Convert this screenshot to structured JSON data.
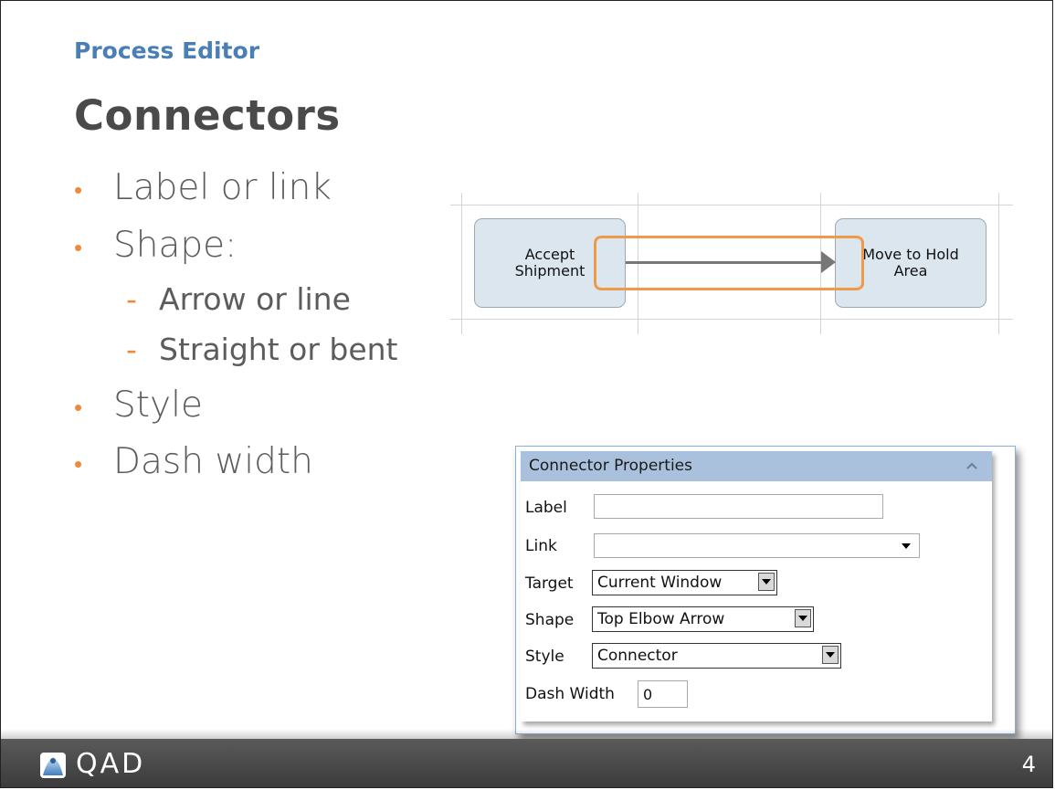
{
  "slide": {
    "subtitle": "Process Editor",
    "title": "Connectors",
    "bullets": [
      {
        "text": "Label or link"
      },
      {
        "text": "Shape:"
      },
      {
        "text": "Style"
      },
      {
        "text": "Dash width"
      }
    ],
    "sub_bullets": [
      {
        "text": "Arrow or line"
      },
      {
        "text": "Straight or bent"
      }
    ]
  },
  "diagram": {
    "node_left": "Accept Shipment",
    "node_left_lines": [
      "Accept",
      "Shipment"
    ],
    "node_right_lines": [
      "Move to Hold",
      "Area"
    ],
    "connector": "arrow",
    "highlight_color": "#ee9a4a"
  },
  "properties_panel": {
    "title": "Connector Properties",
    "collapse_icon": "chevron-up-icon",
    "fields": {
      "label": {
        "label": "Label",
        "value": ""
      },
      "link": {
        "label": "Link",
        "value": ""
      },
      "target": {
        "label": "Target",
        "value": "Current Window"
      },
      "shape": {
        "label": "Shape",
        "value": "Top Elbow Arrow"
      },
      "style": {
        "label": "Style",
        "value": "Connector"
      },
      "dash_width": {
        "label": "Dash Width",
        "value": "0"
      }
    },
    "header_color": "#a9c1dc"
  },
  "footer": {
    "logo_text": "QAD",
    "page_number": "4"
  },
  "colors": {
    "accent_blue": "#4a7fb6",
    "bullet_orange": "#ee8a3c",
    "title_gray": "#4a4a4a"
  }
}
